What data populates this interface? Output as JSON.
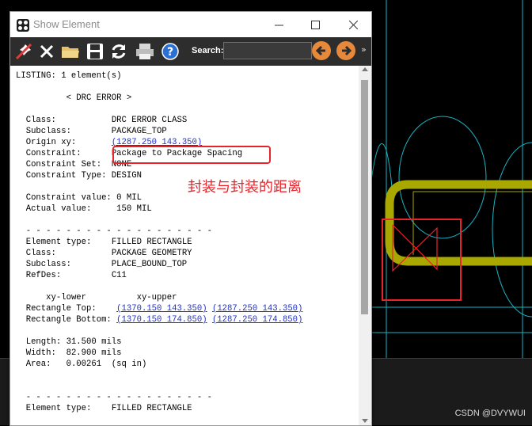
{
  "window": {
    "title": "Show Element"
  },
  "toolbar": {
    "icons": [
      "pin-icon",
      "close-x-icon",
      "folder-icon",
      "save-icon",
      "refresh-icon",
      "print-icon",
      "help-icon",
      "back-icon",
      "forward-icon"
    ],
    "search_label": "Search:",
    "search_value": "",
    "more": "»"
  },
  "listing": {
    "header": "LISTING: 1 element(s)",
    "section_title": "< DRC ERROR >",
    "drc": {
      "class_label": "Class:",
      "class_value": "DRC ERROR CLASS",
      "subclass_label": "Subclass:",
      "subclass_value": "PACKAGE_TOP",
      "origin_label": "Origin xy:",
      "origin_value": "(1287.250 143.350)",
      "constraint_label": "Constraint:",
      "constraint_value": "Package to Package Spacing",
      "constraint_set_label": "Constraint Set:",
      "constraint_set_value": "NONE",
      "constraint_type_label": "Constraint Type:",
      "constraint_type_value": "DESIGN",
      "constraint_value_label": "Constraint value:",
      "constraint_value_value": "0 MIL",
      "actual_label": "Actual value:",
      "actual_value": "150 MIL"
    },
    "divider": "- - - - - - - - - - - - - - - - - - -",
    "element1": {
      "type_label": "Element type:",
      "type_value": "FILLED RECTANGLE",
      "class_label": "Class:",
      "class_value": "PACKAGE GEOMETRY",
      "subclass_label": "Subclass:",
      "subclass_value": "PLACE_BOUND_TOP",
      "refdes_label": "RefDes:",
      "refdes_value": "C11",
      "col_lower": "xy-lower",
      "col_upper": "xy-upper",
      "rect_top_label": "Rectangle Top:",
      "rect_top_lower": "(1370.150 143.350)",
      "rect_top_upper": "(1287.250 143.350)",
      "rect_bottom_label": "Rectangle Bottom:",
      "rect_bottom_lower": "(1370.150 174.850)",
      "rect_bottom_upper": "(1287.250 174.850)",
      "length_label": "Length:",
      "length_value": "31.500 mils",
      "width_label": "Width:",
      "width_value": "82.900 mils",
      "area_label": "Area:",
      "area_value": "0.00261  (sq in)"
    },
    "element2": {
      "type_label": "Element type:",
      "type_value": "FILLED RECTANGLE"
    }
  },
  "annotation": {
    "text": "封装与封装的距离"
  },
  "watermark": "CSDN @DVYWUI",
  "colors": {
    "annotation_red": "#e8242b",
    "copper_yellow": "#a8a800",
    "outline_cyan": "#19b3c3",
    "toolbar_bg": "#2d2d2d",
    "link_blue": "#1f2fc9"
  }
}
